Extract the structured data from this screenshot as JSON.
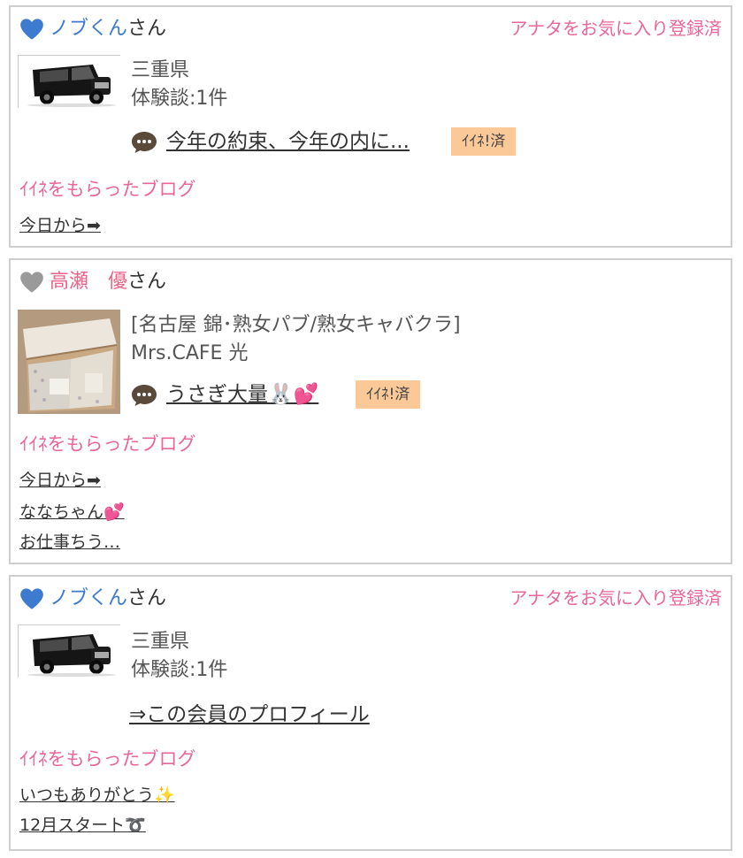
{
  "cards": [
    {
      "name": "ノブくん",
      "name_suffix": "さん",
      "favorite_status": "アナタをお気に入り登録済",
      "heart_color": "#3d7bd0",
      "thumb": "black-car-image",
      "meta": [
        "三重県",
        "体験談:1件"
      ],
      "message": {
        "text": "今年の約束、今年の内に...",
        "badge": "ｲｲﾈ!済"
      },
      "blog_section_title": "ｲｲﾈをもらったブログ",
      "blogs": [
        "今日から➡"
      ]
    },
    {
      "name": "高瀬　優",
      "name_suffix": "さん",
      "heart_color": "#9a9a9a",
      "thumb": "cardboard-box-image",
      "meta": [
        "[名古屋 錦･熟女パブ/熟女キャバクラ]",
        "Mrs.CAFE 光"
      ],
      "message": {
        "text": "うさぎ大量🐰💕",
        "badge": "ｲｲﾈ!済"
      },
      "blog_section_title": "ｲｲﾈをもらったブログ",
      "blogs": [
        "今日から➡",
        "ななちゃん💕",
        "お仕事ちう…"
      ]
    },
    {
      "name": "ノブくん",
      "name_suffix": "さん",
      "favorite_status": "アナタをお気に入り登録済",
      "heart_color": "#3d7bd0",
      "thumb": "black-car-image",
      "meta": [
        "三重県",
        "体験談:1件"
      ],
      "profile_link": "⇒この会員のプロフィール",
      "blog_section_title": "ｲｲﾈをもらったブログ",
      "blogs": [
        "いつもありがとう✨",
        "12月スタート➰"
      ]
    }
  ]
}
